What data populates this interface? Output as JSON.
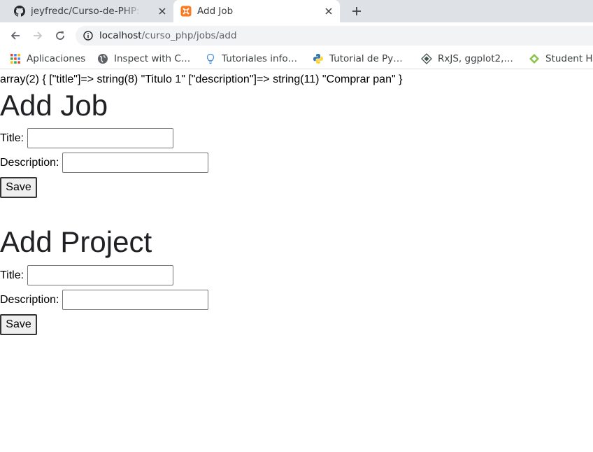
{
  "browser": {
    "tabs": [
      {
        "title": "jeyfredc/Curso-de-PHP: Curso",
        "icon": "github-icon",
        "active": false
      },
      {
        "title": "Add Job",
        "icon": "xampp-icon",
        "active": true
      }
    ],
    "new_tab_label": "+",
    "url": {
      "host": "localhost",
      "path": "/curso_php/jobs/add"
    },
    "bookmarks": [
      {
        "label": "Aplicaciones",
        "icon": "apps-grid-icon"
      },
      {
        "label": "Inspect with C…",
        "icon": "globe-icon"
      },
      {
        "label": "Tutoriales info…",
        "icon": "bulb-icon"
      },
      {
        "label": "Tutorial de Py…",
        "icon": "python-icon"
      },
      {
        "label": "RxJS, ggplot2,…",
        "icon": "diamond-icon"
      },
      {
        "label": "Student H",
        "icon": "leaf-icon"
      }
    ]
  },
  "page": {
    "var_dump": "array(2) { [\"title\"]=> string(8) \"Titulo 1\" [\"description\"]=> string(11) \"Comprar pan\" }",
    "job_form": {
      "heading": "Add Job",
      "title_label": "Title:",
      "title_value": "",
      "description_label": "Description:",
      "description_value": "",
      "save_label": "Save"
    },
    "project_form": {
      "heading": "Add Project",
      "title_label": "Title:",
      "title_value": "",
      "description_label": "Description:",
      "description_value": "",
      "save_label": "Save"
    }
  }
}
